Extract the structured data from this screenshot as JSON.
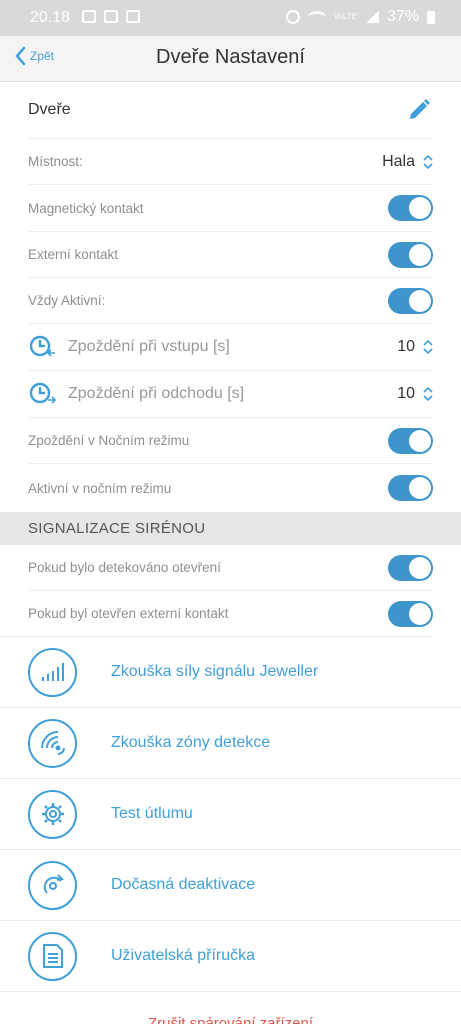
{
  "status_bar": {
    "time": "20.18",
    "battery": "37%",
    "network": "VoLTE"
  },
  "nav": {
    "back_label": "Zpět",
    "title": "Dveře Nastavení"
  },
  "device_name": "Dveře",
  "settings": {
    "room_label": "Místnost:",
    "room_value": "Hala",
    "magnetic_label": "Magnetický kontakt",
    "external_label": "Externí kontakt",
    "always_active_label": "Vždy Aktivní:",
    "entry_delay_label": "Zpoždění při vstupu [s]",
    "entry_delay_value": "10",
    "exit_delay_label": "Zpoždění při odchodu [s]",
    "exit_delay_value": "10",
    "night_delay_label": "Zpoždění v Nočním režimu",
    "night_active_label": "Aktivní v nočním režimu"
  },
  "siren_section": {
    "title": "SIGNALIZACE SIRÉNOU",
    "open_detected_label": "Pokud bylo detekováno otevření",
    "external_open_label": "Pokud byl otevřen externí kontakt"
  },
  "actions": {
    "signal_test": "Zkouška síly signálu Jeweller",
    "zone_test": "Zkouška zóny detekce",
    "attenuation_test": "Test útlumu",
    "temp_deactivation": "Dočasná deaktivace",
    "user_manual": "Uživatelská příručka"
  },
  "bottom_link": "Zrušit spárování zařízení",
  "colors": {
    "accent": "#3f9fd8",
    "toggle_on": "#3d95cc",
    "danger": "#e0554e"
  },
  "icons": [
    "back-chevron-icon",
    "pencil-icon",
    "chevron-updown-icon",
    "timer-enter-icon",
    "timer-exit-icon",
    "signal-bars-icon",
    "zone-waves-icon",
    "gear-icon",
    "deactivation-icon",
    "manual-icon"
  ]
}
